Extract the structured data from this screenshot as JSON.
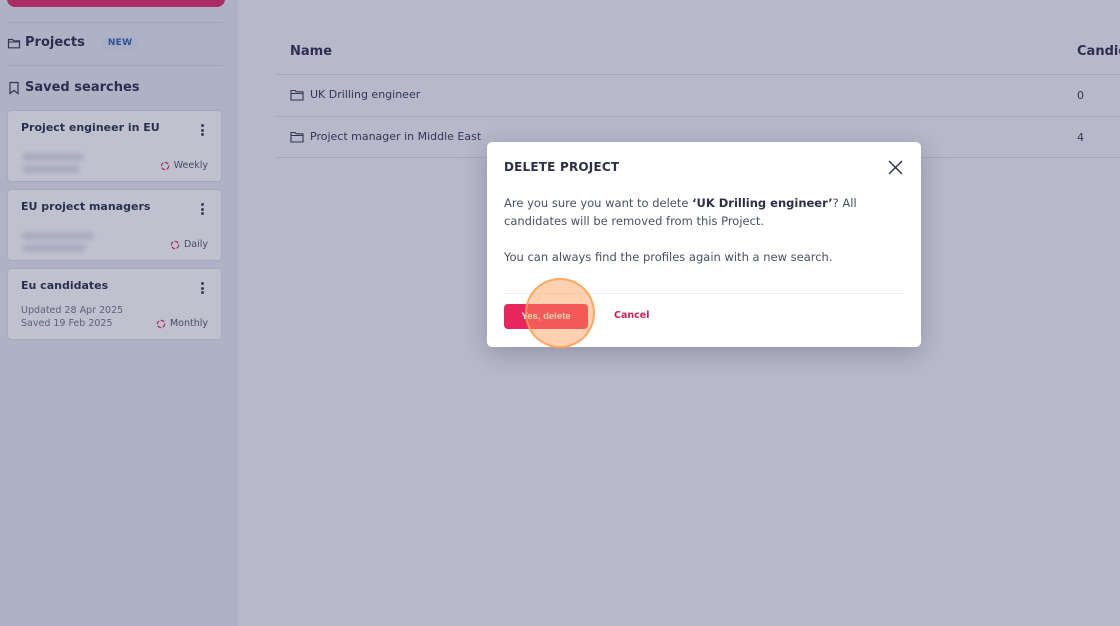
{
  "sidebar": {
    "projects_label": "Projects",
    "projects_badge": "NEW",
    "saved_searches_label": "Saved searches",
    "saved_searches": [
      {
        "title": "Project engineer in EU",
        "frequency": "Weekly"
      },
      {
        "title": "EU project managers",
        "frequency": "Daily"
      },
      {
        "title": "Eu candidates",
        "updated": "Updated  28 Apr 2025",
        "saved": "Saved  19 Feb 2025",
        "frequency": "Monthly"
      }
    ]
  },
  "table": {
    "headers": {
      "name": "Name",
      "candidates": "Candid"
    },
    "rows": [
      {
        "name": "UK Drilling engineer",
        "count": "0"
      },
      {
        "name": "Project manager in Middle East",
        "count": "4"
      }
    ]
  },
  "modal": {
    "title": "DELETE PROJECT",
    "body_prefix": "Are you sure you want to delete ",
    "project_name": "‘UK Drilling engineer’",
    "body_suffix": "? All candidates will be removed from this Project.",
    "body_second": "You can always find the profiles again with a new search.",
    "confirm_label": "Yes, delete",
    "cancel_label": "Cancel"
  },
  "colors": {
    "accent": "#e8265e",
    "accent_text": "#c9234f",
    "overlay": "#3e426e",
    "click_indicator": "#ff9950"
  },
  "icons": {
    "projects": "folder-icon",
    "saved_searches": "bookmark-icon",
    "frequency": "refresh-icon",
    "card_menu": "kebab-menu-icon",
    "row": "folder-icon",
    "close": "close-icon"
  }
}
